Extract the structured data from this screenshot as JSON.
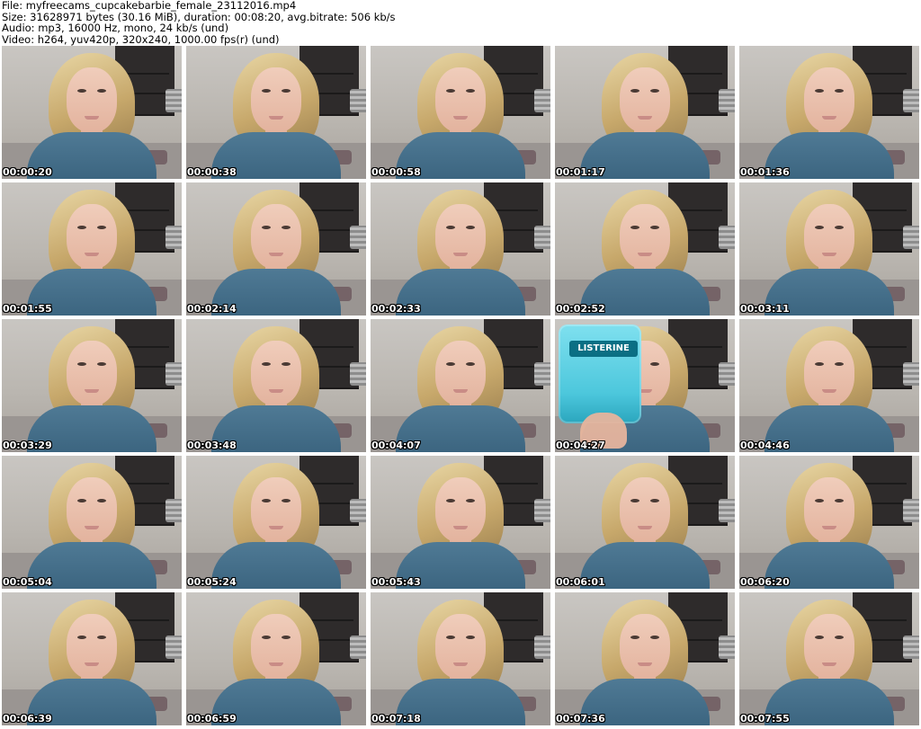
{
  "header": {
    "file_line": "File: myfreecams_cupcakebarbie_female_23112016.mp4",
    "size_line": "Size: 31628971 bytes (30.16 MiB), duration: 00:08:20, avg.bitrate: 506 kb/s",
    "audio_line": "Audio: mp3, 16000 Hz, mono, 24 kb/s (und)",
    "video_line": "Video: h264, yuv420p, 320x240, 1000.00 fps(r) (und)"
  },
  "thumbnails": [
    {
      "timestamp": "00:00:20"
    },
    {
      "timestamp": "00:00:38"
    },
    {
      "timestamp": "00:00:58"
    },
    {
      "timestamp": "00:01:17"
    },
    {
      "timestamp": "00:01:36"
    },
    {
      "timestamp": "00:01:55"
    },
    {
      "timestamp": "00:02:14"
    },
    {
      "timestamp": "00:02:33"
    },
    {
      "timestamp": "00:02:52"
    },
    {
      "timestamp": "00:03:11"
    },
    {
      "timestamp": "00:03:29"
    },
    {
      "timestamp": "00:03:48"
    },
    {
      "timestamp": "00:04:07"
    },
    {
      "timestamp": "00:04:27",
      "overlay_text": "LISTERINE"
    },
    {
      "timestamp": "00:04:46"
    },
    {
      "timestamp": "00:05:04"
    },
    {
      "timestamp": "00:05:24"
    },
    {
      "timestamp": "00:05:43"
    },
    {
      "timestamp": "00:06:01"
    },
    {
      "timestamp": "00:06:20"
    },
    {
      "timestamp": "00:06:39"
    },
    {
      "timestamp": "00:06:59"
    },
    {
      "timestamp": "00:07:18"
    },
    {
      "timestamp": "00:07:36"
    },
    {
      "timestamp": "00:07:55"
    }
  ],
  "colors": {
    "background": "#ffffff",
    "timestamp_text": "#ffffff",
    "timestamp_outline": "#000000",
    "shirt": "#4f7a95"
  }
}
